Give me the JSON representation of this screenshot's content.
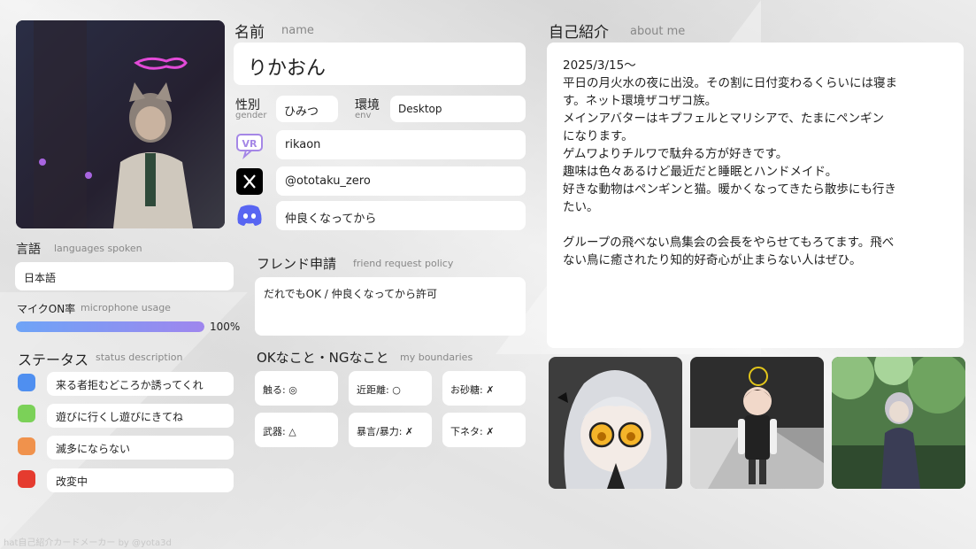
{
  "name_section": {
    "label_jp": "名前",
    "label_en": "name",
    "value": "りかおん"
  },
  "gender": {
    "label_jp": "性別",
    "label_en": "gender",
    "value": "ひみつ"
  },
  "env": {
    "label_jp": "環境",
    "label_en": "env",
    "value": "Desktop"
  },
  "accounts": [
    {
      "icon": "vrchat-icon",
      "value": "rikaon"
    },
    {
      "icon": "x-logo-icon",
      "value": "@ototaku_zero"
    },
    {
      "icon": "discord-icon",
      "value": "仲良くなってから"
    }
  ],
  "languages": {
    "label_jp": "言語",
    "label_en": "languages spoken",
    "value": "日本語"
  },
  "mic": {
    "label_jp": "マイクON率",
    "label_en": "microphone usage",
    "percent_text": "100%",
    "fraction": 1.0
  },
  "status": {
    "label_jp": "ステータス",
    "label_en": "status description",
    "items": [
      {
        "color": "#4f8ff0",
        "text": "来る者拒むどころか誘ってくれ"
      },
      {
        "color": "#7bd158",
        "text": "遊びに行くし遊びにきてね"
      },
      {
        "color": "#f0924c",
        "text": "滅多にならない"
      },
      {
        "color": "#e53b2f",
        "text": "改変中"
      }
    ]
  },
  "friend_request": {
    "label_jp": "フレンド申請",
    "label_en": "friend request policy",
    "value": "だれでもOK / 仲良くなってから許可"
  },
  "boundaries": {
    "label_jp": "OKなこと・NGなこと",
    "label_en": "my boundaries",
    "items": [
      "触る: ◎",
      "近距離: ○",
      "お砂糖: ✗",
      "武器: △",
      "暴言/暴力: ✗",
      "下ネタ: ✗"
    ]
  },
  "about": {
    "label_jp": "自己紹介",
    "label_en": "about me",
    "lines": [
      "2025/3/15〜",
      "平日の月火水の夜に出没。その割に日付変わるくらいには寝ま",
      "す。ネット環境ザコザコ族。",
      "メインアバターはキプフェルとマリシアで、たまにペンギン",
      "になります。",
      "ゲムワよりチルワで駄弁る方が好きです。",
      "趣味は色々あるけど最近だと睡眠とハンドメイド。",
      "好きな動物はペンギンと猫。暖かくなってきたら散歩にも行き",
      "たい。",
      "",
      "グループの飛べない鳥集会の会長をやらせてもろてます。飛べ",
      "ない鳥に癒されたり知的好奇心が止まらない人はぜひ。"
    ]
  },
  "footer": "hat自己紹介カードメーカー by @yota3d"
}
